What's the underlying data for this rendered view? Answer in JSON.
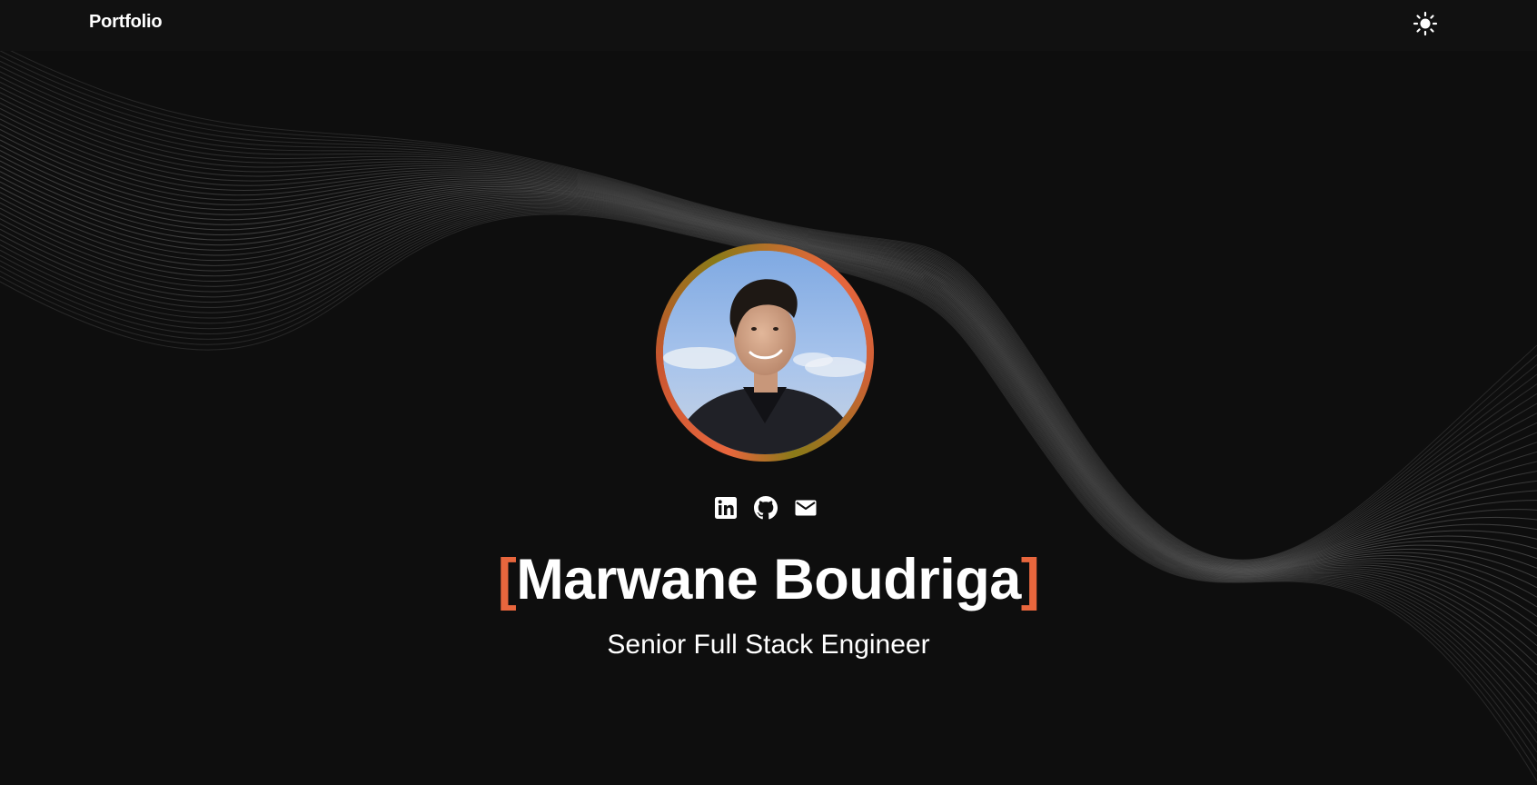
{
  "nav": {
    "brand": "Portfolio",
    "theme_toggle_icon": "sun-icon"
  },
  "hero": {
    "avatar_alt": "profile-photo",
    "socials": [
      {
        "icon": "linkedin-icon"
      },
      {
        "icon": "github-icon"
      },
      {
        "icon": "mail-icon"
      }
    ],
    "name_open_bracket": "[",
    "name": "Marwane Boudriga",
    "name_close_bracket": "]",
    "subtitle": "Senior Full Stack Engineer"
  },
  "colors": {
    "background": "#0e0e0e",
    "navbar": "#111111",
    "accent": "#e8663d",
    "ring_secondary": "#8a7a18",
    "wave_lines": "#5a5a5a",
    "text": "#ffffff"
  }
}
